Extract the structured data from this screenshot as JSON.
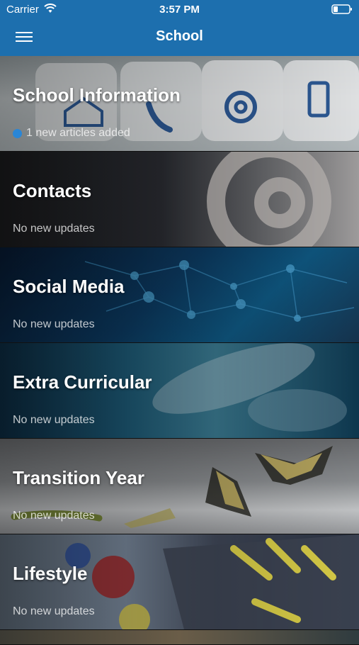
{
  "status_bar": {
    "carrier": "Carrier",
    "time": "3:57 PM"
  },
  "nav": {
    "title": "School",
    "menu_icon": "hamburger-menu-icon"
  },
  "categories": [
    {
      "title": "School Information",
      "subtitle": "1 new articles added",
      "has_new": true
    },
    {
      "title": "Contacts",
      "subtitle": "No new updates",
      "has_new": false
    },
    {
      "title": "Social Media",
      "subtitle": "No new updates",
      "has_new": false
    },
    {
      "title": "Extra Curricular",
      "subtitle": "No new updates",
      "has_new": false
    },
    {
      "title": "Transition Year",
      "subtitle": "No new updates",
      "has_new": false
    },
    {
      "title": "Lifestyle",
      "subtitle": "No new updates",
      "has_new": false
    }
  ],
  "colors": {
    "nav_bar": "#1d6fae",
    "new_dot": "#2a86d6"
  }
}
